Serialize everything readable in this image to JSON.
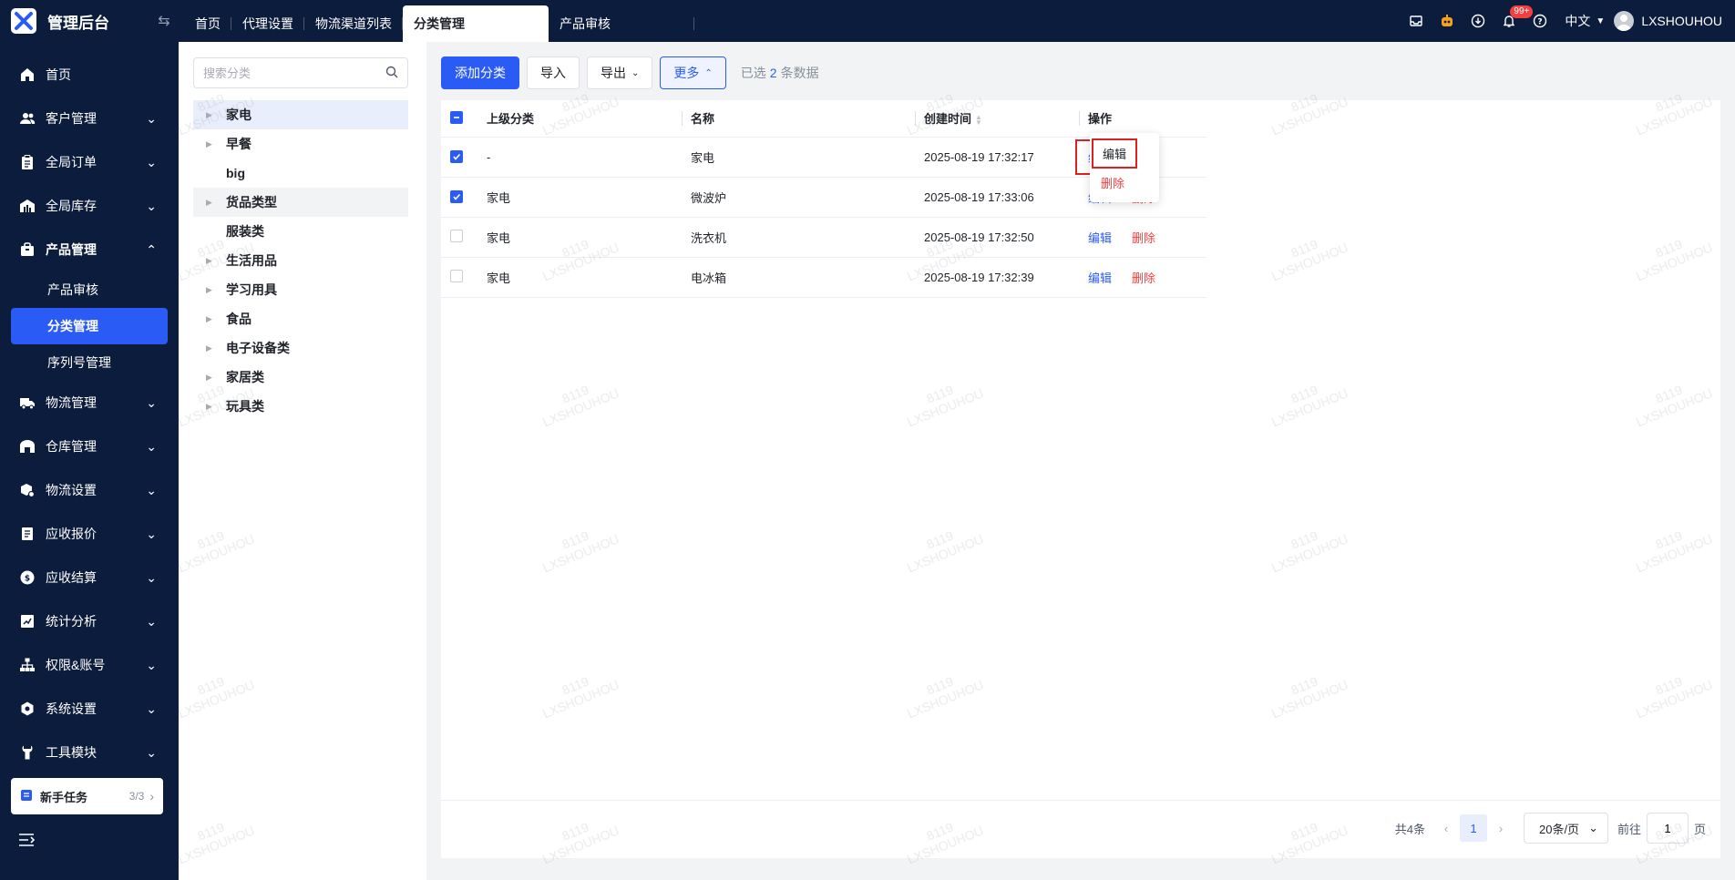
{
  "app": {
    "title": "管理后台"
  },
  "tabs": [
    {
      "label": "首页"
    },
    {
      "label": "代理设置"
    },
    {
      "label": "物流渠道列表"
    },
    {
      "label": "分类管理",
      "active": true
    },
    {
      "label": "产品审核"
    }
  ],
  "topbar": {
    "notification_badge": "99+",
    "language": "中文",
    "username": "LXSHOUHOU"
  },
  "sidebar": {
    "items": [
      {
        "label": "首页",
        "icon": "home-icon"
      },
      {
        "label": "客户管理",
        "icon": "users-icon"
      },
      {
        "label": "全局订单",
        "icon": "clipboard-icon"
      },
      {
        "label": "全局库存",
        "icon": "warehouse-icon"
      },
      {
        "label": "产品管理",
        "icon": "bag-icon",
        "expanded": true
      },
      {
        "label": "物流管理",
        "icon": "truck-icon"
      },
      {
        "label": "仓库管理",
        "icon": "store-icon"
      },
      {
        "label": "物流设置",
        "icon": "box-gear-icon"
      },
      {
        "label": "应收报价",
        "icon": "document-icon"
      },
      {
        "label": "应收结算",
        "icon": "coin-icon"
      },
      {
        "label": "统计分析",
        "icon": "chart-icon"
      },
      {
        "label": "权限&账号",
        "icon": "org-icon"
      },
      {
        "label": "系统设置",
        "icon": "settings-icon"
      },
      {
        "label": "工具模块",
        "icon": "wrench-icon"
      }
    ],
    "sub_items": [
      {
        "label": "产品审核"
      },
      {
        "label": "分类管理",
        "active": true
      },
      {
        "label": "序列号管理"
      }
    ],
    "task": {
      "label": "新手任务",
      "count": "3/3"
    }
  },
  "tree": {
    "search_placeholder": "搜索分类",
    "nodes": [
      {
        "label": "家电",
        "has_children": true
      },
      {
        "label": "早餐",
        "has_children": true
      },
      {
        "label": "big",
        "has_children": false
      },
      {
        "label": "货品类型",
        "has_children": true
      },
      {
        "label": "服装类",
        "has_children": false
      },
      {
        "label": "生活用品",
        "has_children": true
      },
      {
        "label": "学习用具",
        "has_children": true
      },
      {
        "label": "食品",
        "has_children": true
      },
      {
        "label": "电子设备类",
        "has_children": true
      },
      {
        "label": "家居类",
        "has_children": true
      },
      {
        "label": "玩具类",
        "has_children": true
      }
    ]
  },
  "toolbar": {
    "add_label": "添加分类",
    "import_label": "导入",
    "export_label": "导出",
    "more_label": "更多",
    "selected_prefix": "已选",
    "selected_count": "2",
    "selected_suffix": "条数据"
  },
  "dropdown": {
    "edit_label": "编辑",
    "delete_label": "删除"
  },
  "table": {
    "columns": [
      "上级分类",
      "名称",
      "创建时间",
      "操作"
    ],
    "rows": [
      {
        "parent": "-",
        "name": "家电",
        "created": "2025-08-19 17:32:17",
        "checked": true
      },
      {
        "parent": "家电",
        "name": "微波炉",
        "created": "2025-08-19 17:33:06",
        "checked": true
      },
      {
        "parent": "家电",
        "name": "洗衣机",
        "created": "2025-08-19 17:32:50",
        "checked": false
      },
      {
        "parent": "家电",
        "name": "电冰箱",
        "created": "2025-08-19 17:32:39",
        "checked": false
      }
    ],
    "edit_label": "编辑",
    "delete_label": "删除"
  },
  "pagination": {
    "total": "共4条",
    "current_page": "1",
    "page_size": "20条/页",
    "goto_prefix": "前往",
    "goto_value": "1",
    "goto_suffix": "页"
  },
  "watermark": {
    "line1": "8119",
    "line2": "LXSHOUHOU"
  },
  "colors": {
    "primary": "#2b5bf5",
    "danger": "#f53f3f",
    "nav_bg": "#0c1c3c"
  }
}
